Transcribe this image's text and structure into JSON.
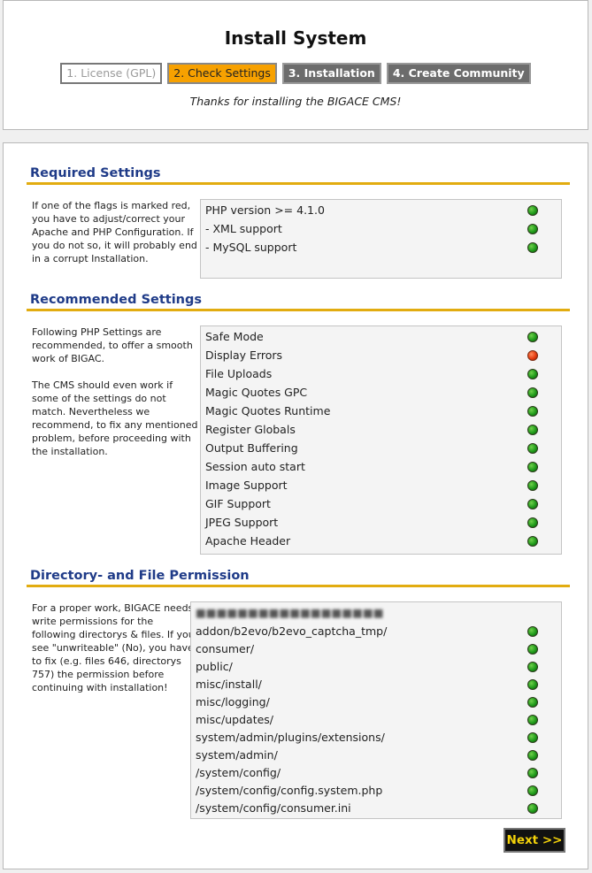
{
  "header": {
    "title": "Install System",
    "steps": [
      {
        "label": "1. License (GPL)",
        "state": "done"
      },
      {
        "label": "2. Check Settings",
        "state": "active"
      },
      {
        "label": "3. Installation",
        "state": "todo"
      },
      {
        "label": "4. Create Community",
        "state": "todo"
      }
    ],
    "tagline": "Thanks for installing the BIGACE CMS!"
  },
  "required": {
    "title": "Required Settings",
    "description": "If one of the flags is marked red, you have to adjust/correct your Apache and PHP Configuration. If you do not so, it will probably end in a corrupt Installation.",
    "items": [
      {
        "label": "PHP version >= 4.1.0",
        "status": "green"
      },
      {
        "label": "- XML support",
        "status": "green"
      },
      {
        "label": "- MySQL support",
        "status": "green"
      }
    ]
  },
  "recommended": {
    "title": "Recommended Settings",
    "description_1": "Following PHP Settings are recommended, to offer a smooth work of BIGAC.",
    "description_2": "The CMS should even work if some of the settings do not match. Nevertheless we recommend, to fix any mentioned problem, before proceeding with the installation.",
    "items": [
      {
        "label": "Safe Mode",
        "status": "green"
      },
      {
        "label": "Display Errors",
        "status": "red"
      },
      {
        "label": "File Uploads",
        "status": "green"
      },
      {
        "label": "Magic Quotes GPC",
        "status": "green"
      },
      {
        "label": "Magic Quotes Runtime",
        "status": "green"
      },
      {
        "label": "Register Globals",
        "status": "green"
      },
      {
        "label": "Output Buffering",
        "status": "green"
      },
      {
        "label": "Session auto start",
        "status": "green"
      },
      {
        "label": "Image Support",
        "status": "green"
      },
      {
        "label": "GIF Support",
        "status": "green"
      },
      {
        "label": "JPEG Support",
        "status": "green"
      },
      {
        "label": "Apache Header",
        "status": "green"
      }
    ]
  },
  "permissions": {
    "title": "Directory- and File Permission",
    "description": "For a proper work, BIGACE needs write permissions for the following directorys & files. If you see \"unwriteable\" (No), you have to fix (e.g. files 646, directorys 757) the permission before continuing with installation!",
    "items": [
      {
        "label": "addon/b2evo/b2evo_captcha_tmp/",
        "status": "green"
      },
      {
        "label": "consumer/",
        "status": "green"
      },
      {
        "label": "public/",
        "status": "green"
      },
      {
        "label": "misc/install/",
        "status": "green"
      },
      {
        "label": "misc/logging/",
        "status": "green"
      },
      {
        "label": "misc/updates/",
        "status": "green"
      },
      {
        "label": "system/admin/plugins/extensions/",
        "status": "green"
      },
      {
        "label": "system/admin/",
        "status": "green"
      },
      {
        "label": "/system/config/",
        "status": "green"
      },
      {
        "label": "/system/config/config.system.php",
        "status": "green"
      },
      {
        "label": "/system/config/consumer.ini",
        "status": "green"
      }
    ]
  },
  "next_button": "Next >>"
}
